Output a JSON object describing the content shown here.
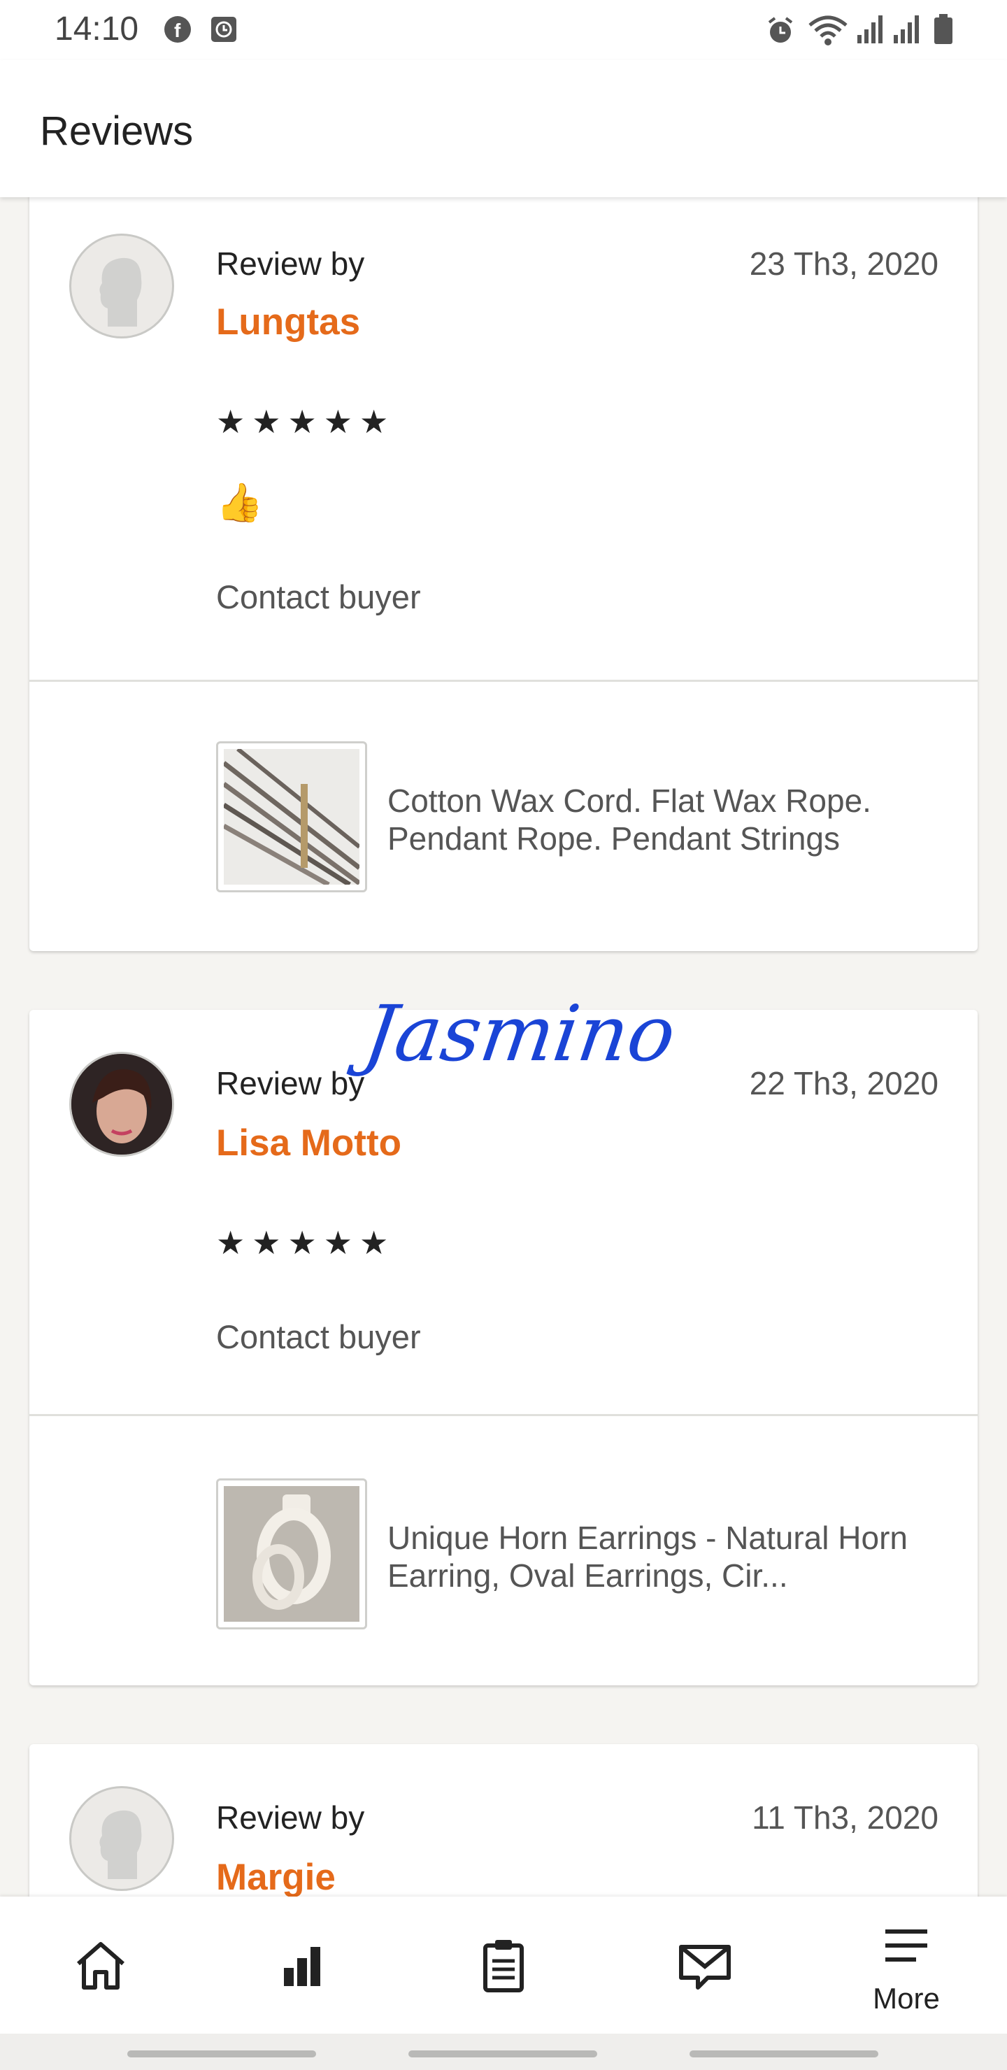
{
  "status_bar": {
    "time": "14:10",
    "icons": [
      "facebook-icon",
      "clock-app-icon",
      "alarm-icon",
      "wifi-icon",
      "signal-icon",
      "signal-icon-2",
      "battery-icon"
    ]
  },
  "header": {
    "title": "Reviews"
  },
  "reviews": [
    {
      "review_by_label": "Review by",
      "reviewer": "Lungtas",
      "date": "23 Th3, 2020",
      "stars": "★★★★★",
      "rating": 5,
      "comment": "👍",
      "contact_label": "Contact buyer",
      "product_title": "Cotton Wax Cord. Flat Wax Rope. Pendant Rope. Pendant Strings",
      "avatar": "default-avatar-icon"
    },
    {
      "review_by_label": "Review by",
      "reviewer": "Lisa Motto",
      "date": "22 Th3, 2020",
      "stars": "★★★★★",
      "rating": 5,
      "contact_label": "Contact buyer",
      "product_title": "Unique Horn Earrings - Natural Horn Earring, Oval Earrings, Cir...",
      "avatar": "photo-avatar",
      "signature_overlay": "Jasmino"
    },
    {
      "review_by_label": "Review by",
      "reviewer": "Margie",
      "date": "11 Th3, 2020",
      "avatar": "default-avatar-icon"
    }
  ],
  "bottom_nav": {
    "items": [
      "home-icon",
      "stats-icon",
      "orders-icon",
      "messages-icon",
      "menu-icon"
    ],
    "more_label": "More"
  },
  "colors": {
    "accent": "#e56a1a",
    "background": "#f5f4f1",
    "signature": "#1a44d6"
  }
}
